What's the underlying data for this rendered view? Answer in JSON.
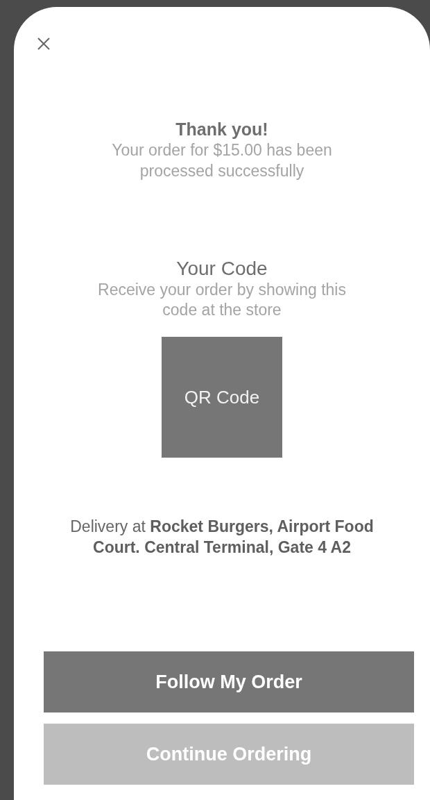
{
  "confirmation": {
    "title": "Thank you!",
    "message": "Your order for $15.00 has been processed successfully"
  },
  "code": {
    "title": "Your Code",
    "message": "Receive your order by showing this code at the store",
    "qr_label": "QR Code"
  },
  "delivery": "Delivery at **Rocket Burgers, Airport Food Court. Central Terminal, Gate 4 A2**",
  "buttons": [
    {
      "label": "Follow My Order",
      "kind": "primary"
    },
    {
      "label": "Continue Ordering",
      "kind": "secondary"
    }
  ]
}
